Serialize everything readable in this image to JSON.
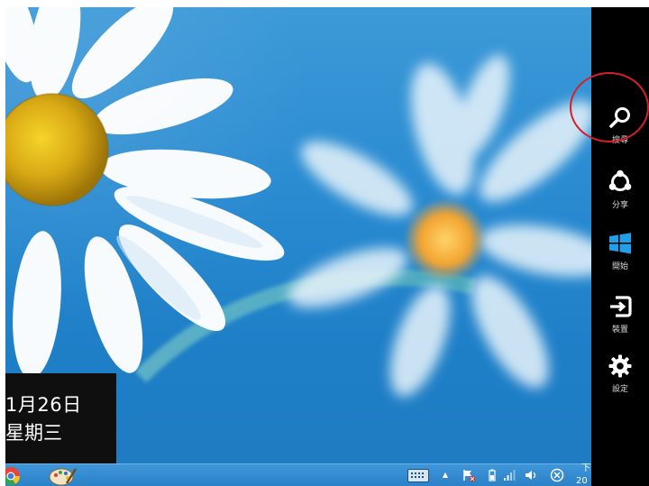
{
  "clock": {
    "date": "1月26日",
    "weekday": "星期三"
  },
  "charms": [
    {
      "label": "搜尋",
      "icon": "search-icon"
    },
    {
      "label": "分享",
      "icon": "share-icon"
    },
    {
      "label": "開始",
      "icon": "windows-start-icon"
    },
    {
      "label": "裝置",
      "icon": "devices-icon"
    },
    {
      "label": "設定",
      "icon": "settings-gear-icon"
    }
  ],
  "taskbar": {
    "apps": [
      {
        "name": "chrome-icon"
      },
      {
        "name": "paint-icon"
      }
    ],
    "tray": {
      "keyboard_icon": "touch-keyboard-icon",
      "chevron": "▲",
      "time_partial": "下",
      "date_partial": "20"
    }
  },
  "colors": {
    "charms_background": "#000000",
    "highlight": "#d5202a",
    "desktop_sky": "#2a8bd1"
  }
}
